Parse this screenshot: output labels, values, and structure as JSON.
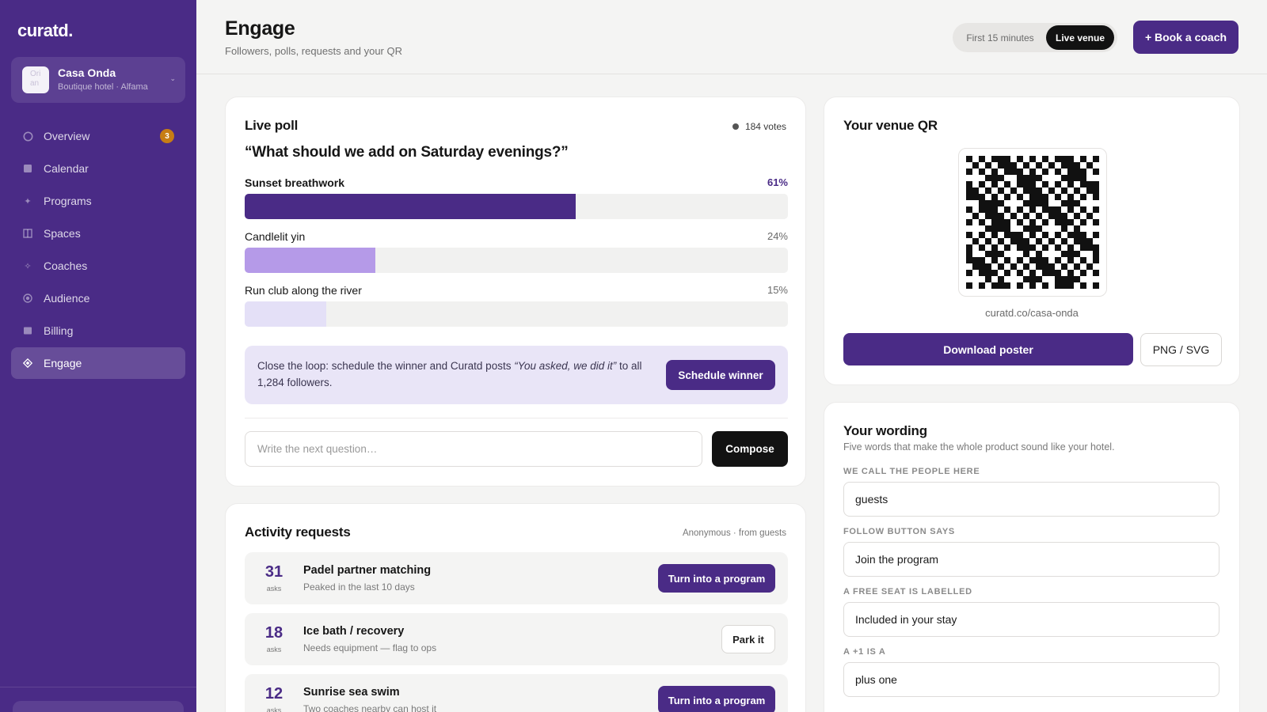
{
  "app": {
    "logo": "curatd."
  },
  "venue": {
    "avatar_text": "Ori an",
    "name": "Casa Onda",
    "subtitle": "Boutique hotel · Alfama"
  },
  "nav": [
    {
      "label": "Overview",
      "icon": "overview-circle-icon",
      "badge": "3"
    },
    {
      "label": "Calendar",
      "icon": "calendar-icon"
    },
    {
      "label": "Programs",
      "icon": "programs-sparkle-icon"
    },
    {
      "label": "Spaces",
      "icon": "spaces-grid-icon"
    },
    {
      "label": "Coaches",
      "icon": "coaches-diamond-icon"
    },
    {
      "label": "Audience",
      "icon": "audience-icon"
    },
    {
      "label": "Billing",
      "icon": "billing-icon"
    },
    {
      "label": "Engage",
      "icon": "engage-diamond-icon",
      "active": true
    }
  ],
  "header": {
    "title": "Engage",
    "subtitle": "Followers, polls, requests and your QR",
    "mode_options": [
      "First 15 minutes",
      "Live venue"
    ],
    "mode_selected": "Live venue",
    "book_button": "+ Book a coach"
  },
  "poll": {
    "title": "Live poll",
    "votes": "184 votes",
    "question": "“What should we add on Saturday evenings?”",
    "options": [
      {
        "label": "Sunset breathwork",
        "pct_label": "61%",
        "pct": 61,
        "color": "#4a2b86"
      },
      {
        "label": "Candlelit yin",
        "pct_label": "24%",
        "pct": 24,
        "color": "#b59ae8"
      },
      {
        "label": "Run club along the river",
        "pct_label": "15%",
        "pct": 15,
        "color": "#e4e0f7"
      }
    ],
    "loop": {
      "text_before": "Close the loop: schedule the winner and Curatd posts ",
      "quote": "“You asked, we did it”",
      "text_after": " to all 1,284 followers.",
      "button": "Schedule winner"
    },
    "composer": {
      "placeholder": "Write the next question…",
      "button": "Compose"
    }
  },
  "requests": {
    "title": "Activity requests",
    "meta": "Anonymous · from guests",
    "items": [
      {
        "count": "31",
        "unit": "asks",
        "title": "Padel partner matching",
        "subtitle": "Peaked in the last 10 days",
        "action": "Turn into a program",
        "primary": true
      },
      {
        "count": "18",
        "unit": "asks",
        "title": "Ice bath / recovery",
        "subtitle": "Needs equipment — flag to ops",
        "action": "Park it",
        "primary": false
      },
      {
        "count": "12",
        "unit": "asks",
        "title": "Sunrise sea swim",
        "subtitle": "Two coaches nearby can host it",
        "action": "Turn into a program",
        "primary": true
      }
    ]
  },
  "qr": {
    "title": "Your venue QR",
    "url": "curatd.co/casa-onda",
    "download_button": "Download poster",
    "format_button": "PNG / SVG"
  },
  "wording": {
    "title": "Your wording",
    "subtitle": "Five words that make the whole product sound like your hotel.",
    "fields": [
      {
        "label": "WE CALL THE PEOPLE HERE",
        "value": "guests"
      },
      {
        "label": "FOLLOW BUTTON SAYS",
        "value": "Join the program"
      },
      {
        "label": "A FREE SEAT IS LABELLED",
        "value": "Included in your stay"
      },
      {
        "label": "A +1 IS A",
        "value": "plus one"
      }
    ]
  },
  "colors": {
    "brand": "#4a2b86",
    "accent_light": "#e9e5f7",
    "badge": "#c77d14",
    "dark": "#121212"
  }
}
